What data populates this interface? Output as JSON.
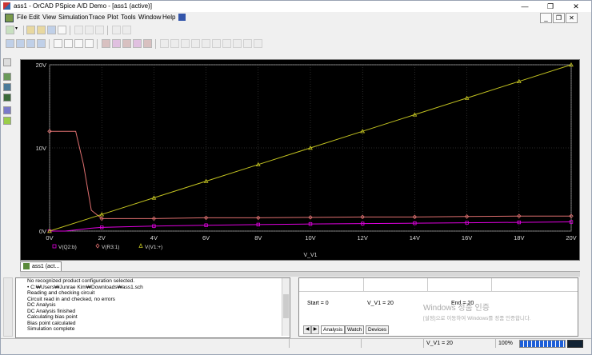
{
  "window": {
    "title": "ass1 - OrCAD PSpice A/D Demo - [ass1 (active)]",
    "controls": [
      "—",
      "❐",
      "✕"
    ]
  },
  "menu": [
    "File",
    "Edit",
    "View",
    "Simulation",
    "Trace",
    "Plot",
    "Tools",
    "Window",
    "Help"
  ],
  "mdi_controls": [
    "_",
    "❐",
    "✕"
  ],
  "chart_data": {
    "type": "line",
    "xlabel": "V_V1",
    "x_ticks": [
      "0V",
      "2V",
      "4V",
      "6V",
      "8V",
      "10V",
      "12V",
      "14V",
      "16V",
      "18V",
      "20V"
    ],
    "y_ticks": [
      "0V",
      "10V",
      "20V"
    ],
    "xlim": [
      0,
      20
    ],
    "ylim": [
      0,
      20
    ],
    "grid": true,
    "legend_position": "bottom-left",
    "legend": [
      "V(Q2:b)",
      "V(R3:1)",
      "V(V1:+)"
    ],
    "series": [
      {
        "name": "V(Q2:b)",
        "color": "#e000e0",
        "marker": "square",
        "x": [
          0,
          0.6,
          1.2,
          1.6,
          2,
          4,
          6,
          8,
          10,
          12,
          14,
          16,
          18,
          20
        ],
        "y": [
          0,
          0.0,
          0.2,
          0.35,
          0.45,
          0.6,
          0.7,
          0.78,
          0.85,
          0.9,
          0.95,
          1.0,
          1.05,
          1.1
        ]
      },
      {
        "name": "V(R3:1)",
        "color": "#e07070",
        "marker": "diamond",
        "x": [
          0,
          0.5,
          1.0,
          1.3,
          1.6,
          2,
          4,
          6,
          8,
          10,
          12,
          14,
          16,
          18,
          20
        ],
        "y": [
          12.0,
          12.0,
          12.0,
          8.0,
          2.5,
          1.5,
          1.5,
          1.6,
          1.6,
          1.65,
          1.7,
          1.7,
          1.75,
          1.8,
          1.8
        ]
      },
      {
        "name": "V(V1:+)",
        "color": "#c0c020",
        "marker": "triangle",
        "x": [
          0,
          2,
          4,
          6,
          8,
          10,
          12,
          14,
          16,
          18,
          20
        ],
        "y": [
          0,
          2,
          4,
          6,
          8,
          10,
          12,
          14,
          16,
          18,
          20
        ]
      }
    ]
  },
  "doc_tab": {
    "label": "ass1 (act..."
  },
  "output_window": {
    "lines": [
      "No recognized product configuration selected.",
      "• C:₩Users₩Junrae Kim₩Downloads₩ass1.sch",
      "Reading and checking circuit",
      "Circuit read in and checked, no errors",
      "DC Analysis",
      "DC Analysis finished",
      "Calculating bias point",
      "Bias point calculated",
      "Simulation complete"
    ]
  },
  "sim_status": {
    "start_label": "Start = 0",
    "value_label": "V_V1 =  20",
    "end_label": "End = 20",
    "tabs": [
      "Analysis",
      "Watch",
      "Devices"
    ]
  },
  "watermark": {
    "line1": "Windows 정품 인증",
    "line2": "[설정]으로 이동하여 Windows를 정품 인증합니다."
  },
  "statusbar": {
    "value": "V_V1 = 20",
    "zoom": "100%"
  }
}
